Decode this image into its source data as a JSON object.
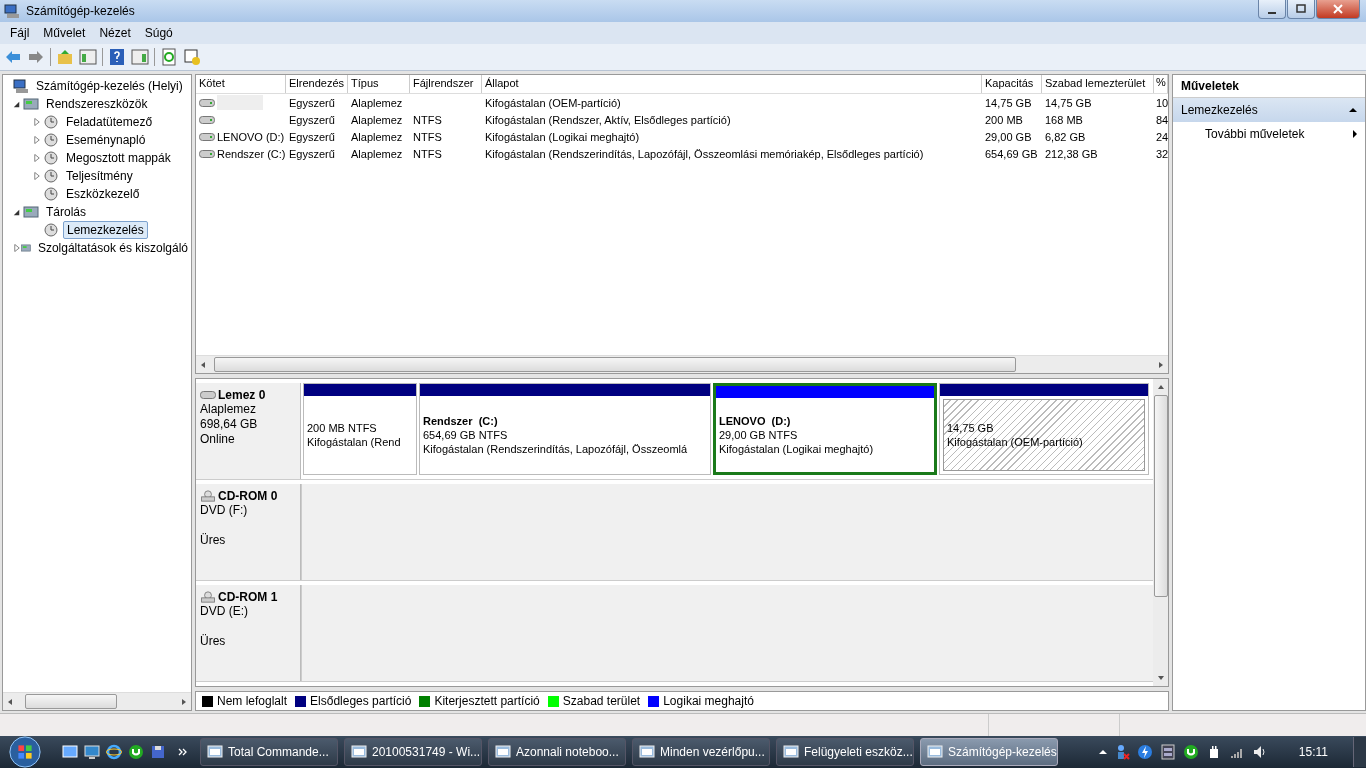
{
  "window": {
    "title": "Számítógép-kezelés"
  },
  "menu": [
    "Fájl",
    "Művelet",
    "Nézet",
    "Súgó"
  ],
  "tree": [
    {
      "label": "Számítógép-kezelés (Helyi)",
      "selected": false,
      "children": [
        {
          "label": "Rendszereszközök",
          "expanded": true,
          "selected": false,
          "children": [
            {
              "label": "Feladatütemező",
              "expanded": false,
              "selected": false
            },
            {
              "label": "Eseménynapló",
              "expanded": false,
              "selected": false
            },
            {
              "label": "Megosztott mappák",
              "expanded": false,
              "selected": false
            },
            {
              "label": "Teljesítmény",
              "expanded": false,
              "selected": false
            },
            {
              "label": "Eszközkezelő",
              "selected": false
            }
          ]
        },
        {
          "label": "Tárolás",
          "expanded": true,
          "selected": false,
          "children": [
            {
              "label": "Lemezkezelés",
              "selected": true
            }
          ]
        },
        {
          "label": "Szolgáltatások és kiszolgáló",
          "expanded": false,
          "selected": false
        }
      ]
    }
  ],
  "table": {
    "columns": [
      "Kötet",
      "Elrendezés",
      "Típus",
      "Fájlrendszer",
      "Állapot",
      "Kapacitás",
      "Szabad lemezterület",
      "%"
    ],
    "rows": [
      {
        "redacted": true,
        "layout": "Egyszerű",
        "type": "Alaplemez",
        "status": "Kifogástalan (OEM-partíció)",
        "capacity": "14,75 GB",
        "free": "14,75 GB",
        "percent": "10"
      },
      {
        "redacted": false,
        "layout": "Egyszerű",
        "type": "Alaplemez",
        "filesystem": "NTFS",
        "status": "Kifogástalan (Rendszer, Aktív, Elsődleges partíció)",
        "capacity": "200 MB",
        "free": "168 MB",
        "percent": "84"
      },
      {
        "redacted": false,
        "volume": "LENOVO (D:)",
        "layout": "Egyszerű",
        "type": "Alaplemez",
        "filesystem": "NTFS",
        "status": "Kifogástalan (Logikai meghajtó)",
        "capacity": "29,00 GB",
        "free": "6,82 GB",
        "percent": "24"
      },
      {
        "redacted": false,
        "volume": "Rendszer (C:)",
        "layout": "Egyszerű",
        "type": "Alaplemez",
        "filesystem": "NTFS",
        "status": "Kifogástalan (Rendszerindítás, Lapozófájl, Összeomlási memóriakép, Elsődleges partíció)",
        "capacity": "654,69 GB",
        "free": "212,38 GB",
        "percent": "32"
      }
    ]
  },
  "disks": [
    {
      "kind": "basic",
      "name": "Lemez 0",
      "type": "Alaplemez",
      "size": "698,64 GB",
      "status": "Online",
      "partitions": [
        {
          "size": "200 MB NTFS",
          "status": "Kifogástalan (Rend",
          "color": "#000080",
          "selected": false,
          "hatched": false
        },
        {
          "label": "Rendszer  (C:)",
          "size": "654,69 GB NTFS",
          "status": "Kifogástalan (Rendszerindítás, Lapozófájl, Összeomlá",
          "color": "#000080",
          "selected": false,
          "hatched": false
        },
        {
          "label": "LENOVO  (D:)",
          "size": "29,00 GB NTFS",
          "status": "Kifogástalan (Logikai meghajtó)",
          "color": "#0000ff",
          "selected": true,
          "hatched": false
        },
        {
          "size": "14,75 GB",
          "status": "Kifogástalan (OEM-partíció)",
          "color": "#000080",
          "selected": false,
          "hatched": true
        }
      ]
    },
    {
      "kind": "cdrom",
      "name": "CD-ROM 0",
      "type": "DVD (F:)",
      "status": "Üres"
    },
    {
      "kind": "cdrom",
      "name": "CD-ROM 1",
      "type": "DVD (E:)",
      "status": "Üres"
    }
  ],
  "legend": [
    {
      "label": "Nem lefoglalt",
      "color": "#000000"
    },
    {
      "label": "Elsődleges partíció",
      "color": "#000080"
    },
    {
      "label": "Kiterjesztett partíció",
      "color": "#008000"
    },
    {
      "label": "Szabad terület",
      "color": "#00ff00"
    },
    {
      "label": "Logikai meghajtó",
      "color": "#0000ff"
    }
  ],
  "actions": {
    "title": "Műveletek",
    "section": "Lemezkezelés",
    "expanded": true,
    "items": [
      "További műveletek"
    ]
  },
  "taskbar": {
    "buttons": [
      {
        "label": "Total Commande...",
        "selected": false
      },
      {
        "label": "20100531749 - Wi...",
        "selected": false
      },
      {
        "label": "Azonnali noteboo...",
        "selected": false
      },
      {
        "label": "Minden vezérlőpu...",
        "selected": false
      },
      {
        "label": "Felügyeleti eszköz...",
        "selected": false
      },
      {
        "label": "Számítógép-kezelés",
        "selected": true
      }
    ],
    "clock": "15:11"
  }
}
